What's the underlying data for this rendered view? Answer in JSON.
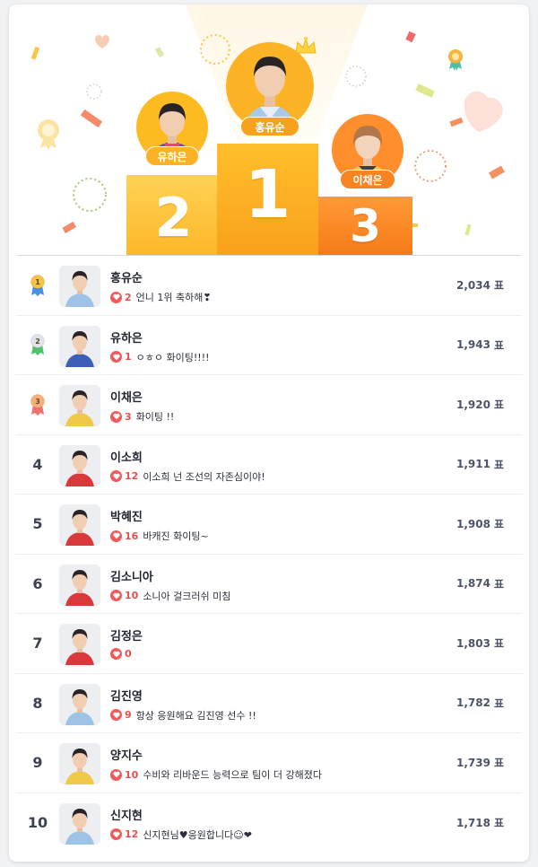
{
  "podium": {
    "first": {
      "rank": "1",
      "name": "홍유순"
    },
    "second": {
      "rank": "2",
      "name": "유하은"
    },
    "third": {
      "rank": "3",
      "name": "이채은"
    }
  },
  "vote_unit": "표",
  "rankings": [
    {
      "rank": "1",
      "medal": true,
      "medal_color": "#f6c343",
      "ribbon_color": "#4a90e2",
      "name": "홍유순",
      "cheer_count": "2",
      "cheer_text": "언니 1위 축하해❣",
      "votes": "2,034",
      "jersey": "#9fc3e6"
    },
    {
      "rank": "2",
      "medal": true,
      "medal_color": "#dfe3ea",
      "ribbon_color": "#4fc36b",
      "name": "유하은",
      "cheer_count": "1",
      "cheer_text": "ㅇㅎㅇ 화이팅!!!!",
      "votes": "1,943",
      "jersey": "#3d5fb8"
    },
    {
      "rank": "3",
      "medal": true,
      "medal_color": "#f7b07a",
      "ribbon_color": "#f07070",
      "name": "이채은",
      "cheer_count": "3",
      "cheer_text": "화이팅 !!",
      "votes": "1,920",
      "jersey": "#f0c84a"
    },
    {
      "rank": "4",
      "medal": false,
      "name": "이소희",
      "cheer_count": "12",
      "cheer_text": "이소희 넌 조선의 자존심이야!",
      "votes": "1,911",
      "jersey": "#d9393a"
    },
    {
      "rank": "5",
      "medal": false,
      "name": "박혜진",
      "cheer_count": "16",
      "cheer_text": "바캐진 화이팅~",
      "votes": "1,908",
      "jersey": "#d9393a"
    },
    {
      "rank": "6",
      "medal": false,
      "name": "김소니아",
      "cheer_count": "10",
      "cheer_text": "소니아 걸크러쉬 미침",
      "votes": "1,874",
      "jersey": "#d9393a"
    },
    {
      "rank": "7",
      "medal": false,
      "name": "김정은",
      "cheer_count": "0",
      "cheer_text": "",
      "votes": "1,803",
      "jersey": "#d9393a"
    },
    {
      "rank": "8",
      "medal": false,
      "name": "김진영",
      "cheer_count": "9",
      "cheer_text": "항상 응원해요 김진영 선수 !!",
      "votes": "1,782",
      "jersey": "#9fc3e6"
    },
    {
      "rank": "9",
      "medal": false,
      "name": "양지수",
      "cheer_count": "10",
      "cheer_text": "수비와 리바운드 능력으로 팀이 더 강해졌다",
      "votes": "1,739",
      "jersey": "#f0c84a"
    },
    {
      "rank": "10",
      "medal": false,
      "name": "신지현",
      "cheer_count": "12",
      "cheer_text": "신지현님♥응원합니다☺❤",
      "votes": "1,718",
      "jersey": "#9fc3e6"
    }
  ]
}
